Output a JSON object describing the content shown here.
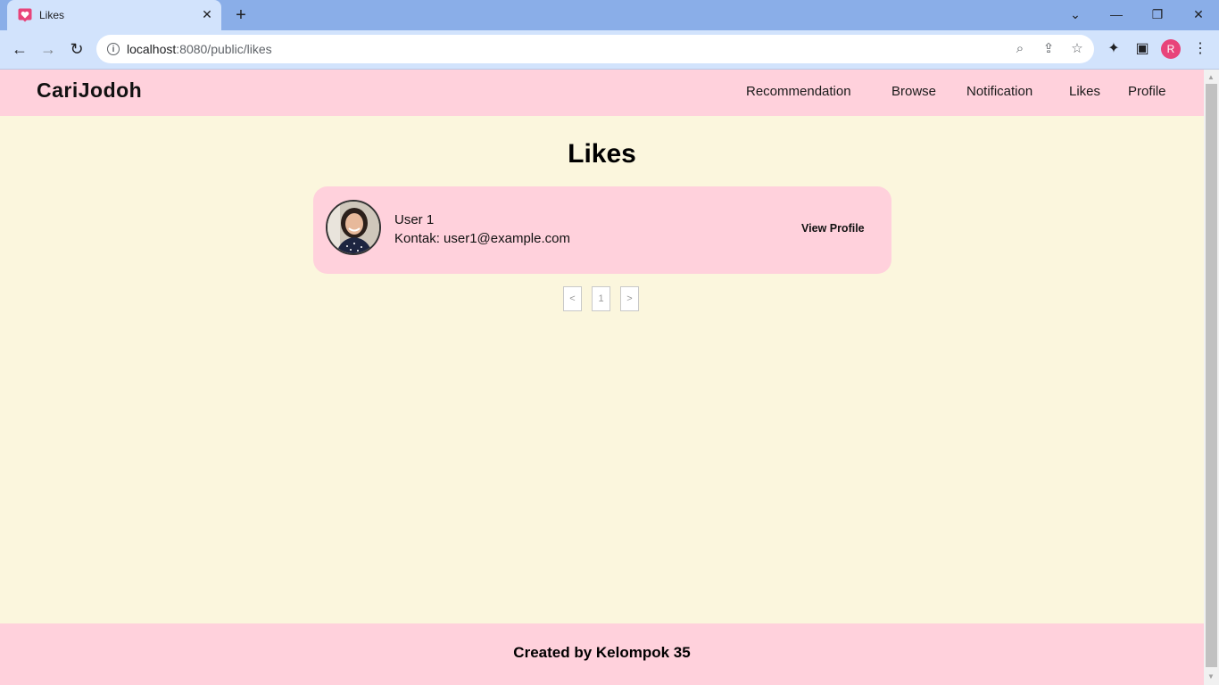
{
  "browser": {
    "tab_title": "Likes",
    "tab_close": "✕",
    "new_tab": "+",
    "url_host": "localhost",
    "url_rest": ":8080/public/likes",
    "profile_initial": "R",
    "minimize": "—",
    "restore": "❐",
    "close": "✕"
  },
  "site": {
    "logo": "CariJodoh",
    "nav": {
      "recommendation": "Recommendation",
      "browse": "Browse",
      "notification": "Notification",
      "likes": "Likes",
      "profile": "Profile"
    },
    "page_title": "Likes",
    "liked_user": {
      "name": "User 1",
      "contact": "Kontak: user1@example.com",
      "view_profile": "View Profile"
    },
    "pagination": {
      "prev": "<",
      "current": "1",
      "next": ">"
    },
    "footer": "Created by Kelompok 35"
  }
}
